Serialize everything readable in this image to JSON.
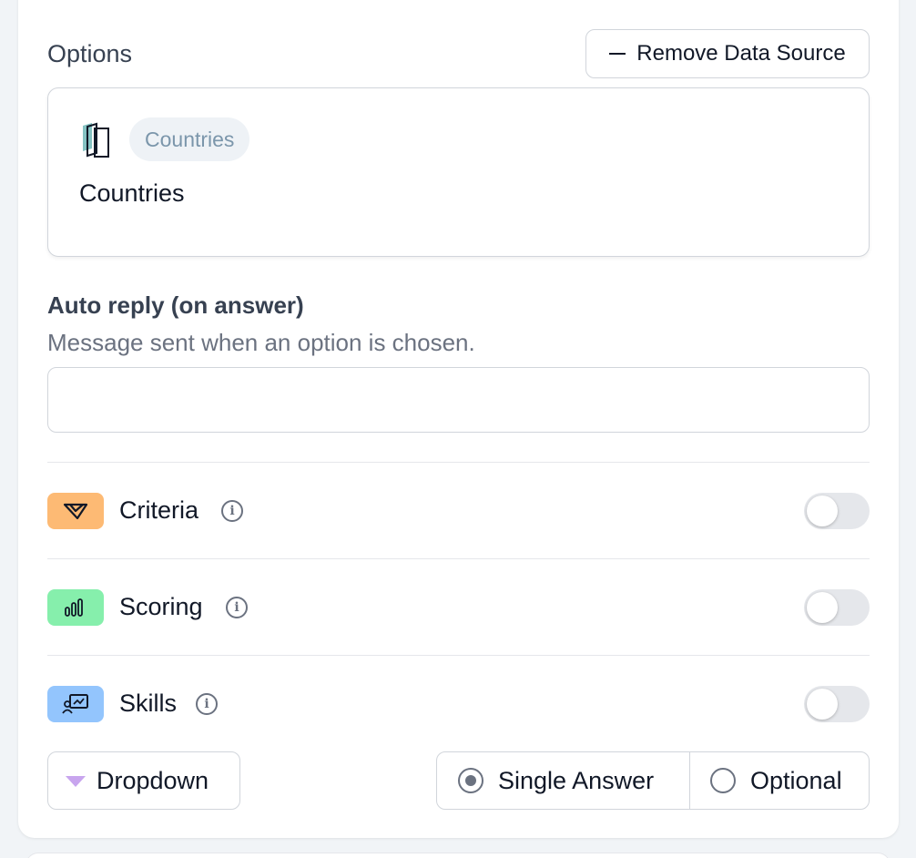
{
  "options": {
    "label": "Options",
    "remove_button": "Remove Data Source"
  },
  "data_source": {
    "tag": "Countries",
    "title": "Countries",
    "icon": "book-icon"
  },
  "auto_reply": {
    "title": "Auto reply (on answer)",
    "subtitle": "Message sent when an option is chosen.",
    "value": ""
  },
  "rows": [
    {
      "label": "Criteria",
      "icon": "criteria-icon",
      "badge_color": "#fdba74",
      "enabled": false
    },
    {
      "label": "Scoring",
      "icon": "bar-chart-icon",
      "badge_color": "#86efac",
      "enabled": false
    },
    {
      "label": "Skills",
      "icon": "skills-icon",
      "badge_color": "#93c5fd",
      "enabled": false
    }
  ],
  "footer": {
    "dropdown_label": "Dropdown",
    "single_answer_label": "Single Answer",
    "optional_label": "Optional",
    "single_answer_selected": true,
    "optional_selected": false
  }
}
